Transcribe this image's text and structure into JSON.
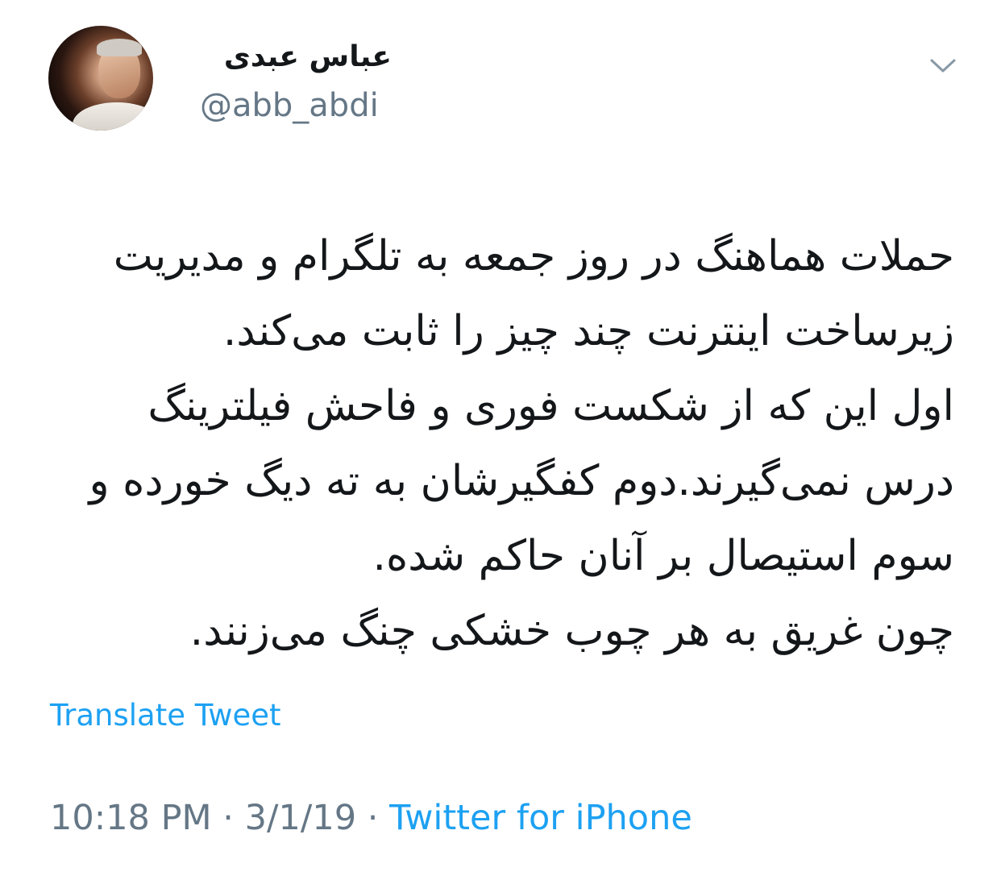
{
  "author": {
    "display_name": "عباس عبدی",
    "handle": "@abb_abdi"
  },
  "tweet": {
    "lines": [
      "حملات هماهنگ در روز جمعه به تلگرام و مدیریت",
      "زیرساخت اینترنت چند چیز را ثابت می‌کند.",
      "اول این که از شکست فوری و فاحش فیلترینگ",
      "درس نمی‌گیرند.دوم کفگیرشان به ته دیگ خورده و",
      "سوم استیصال بر آنان حاکم شده.",
      "چون غریق به هر چوب خشکی چنگ می‌زنند."
    ],
    "translate_label": "Translate Tweet"
  },
  "meta": {
    "time": "10:18 PM",
    "separator": "·",
    "date": "3/1/19",
    "source": "Twitter for iPhone"
  },
  "icons": {
    "menu": "chevron-down-icon",
    "avatar": "profile-photo"
  },
  "colors": {
    "link": "#1da1f2",
    "secondary": "#657786",
    "text": "#14171a"
  }
}
